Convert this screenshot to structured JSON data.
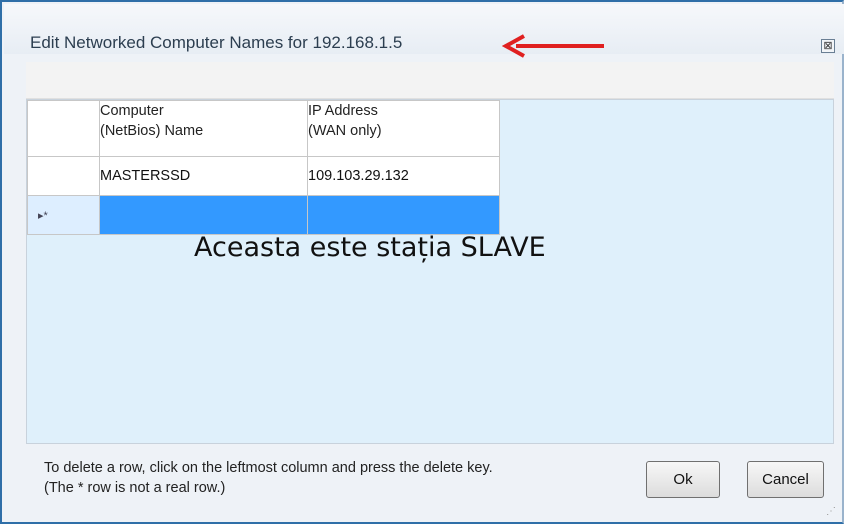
{
  "window": {
    "title": "Edit Networked Computer Names for 192.168.1.5",
    "close_glyph": "⊠"
  },
  "grid": {
    "columns": [
      "Computer\n(NetBios) Name",
      "IP Address\n(WAN only)"
    ],
    "rows": [
      {
        "name": "MASTERSSD",
        "ip": "109.103.29.132"
      }
    ],
    "new_row_marker": "▸*"
  },
  "caption": "Aceasta este stația SLAVE",
  "help": {
    "line1": "To delete a row, click on the leftmost column and press the delete key.",
    "line2": "(The * row is not a real row.)"
  },
  "buttons": {
    "ok": "Ok",
    "cancel": "Cancel"
  },
  "colors": {
    "accent_arrow": "#e02020",
    "selection": "#3399ff",
    "grid_bg": "#dff0fb"
  }
}
